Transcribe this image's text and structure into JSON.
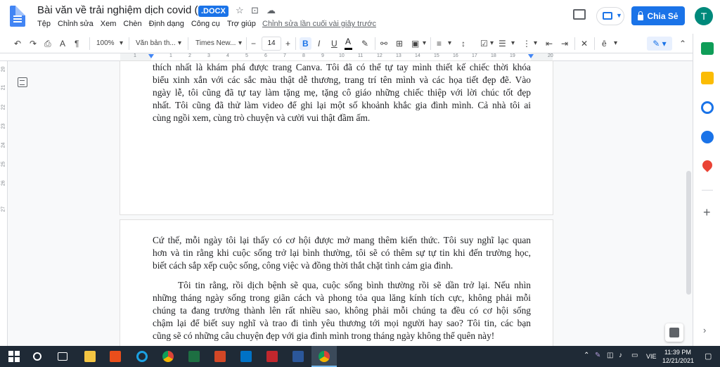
{
  "app": {
    "doc_title": "Bài văn về trải nghiệm dịch covid (1)",
    "file_badge": ".DOCX",
    "last_edit": "Chỉnh sửa lần cuối vài giây trước",
    "share_label": "Chia Sẻ",
    "avatar_initial": "T"
  },
  "menu": [
    "Tệp",
    "Chỉnh sửa",
    "Xem",
    "Chèn",
    "Định dạng",
    "Công cụ",
    "Trợ giúp"
  ],
  "toolbar": {
    "zoom": "100%",
    "style": "Văn bản th...",
    "font": "Times New...",
    "font_size": "14"
  },
  "ruler": {
    "numbers": [
      "1",
      "1",
      "2",
      "3",
      "4",
      "5",
      "6",
      "7",
      "8",
      "9",
      "10",
      "11",
      "12",
      "13",
      "14",
      "15",
      "16",
      "17",
      "18",
      "19",
      "20"
    ],
    "vertical_numbers": [
      "20",
      "21",
      "22",
      "23",
      "24",
      "25",
      "26",
      "27"
    ]
  },
  "page1": {
    "lines": [
      "thích nhất là khám phá được trang Canva. Tôi đã có thể tự tay mình thiết kế chiếc thời khóa",
      "biểu xinh xắn với các sắc màu thật dễ thương, trang trí tên mình và các họa tiết đẹp đẽ. Vào",
      "ngày lễ, tôi cũng đã tự tay làm tặng mẹ, tặng cô giáo những chiếc thiệp với lời chúc tốt đẹp",
      "nhất. Tôi cũng đã thử làm video để ghi lại một số khoảnh khắc gia đình mình. Cả nhà tôi ai",
      "cùng ngồi xem, cùng trò chuyện và cười vui thật đầm ấm."
    ]
  },
  "page2": {
    "para1": [
      "Cứ thế, mỗi ngày tôi lại thấy có cơ hội được mở mang thêm kiến thức. Tôi suy nghĩ lạc quan",
      "hơn và tin rằng khi cuộc sống trở lại bình thường, tôi sẽ có thêm sự tự tin khi đến trường học,",
      "biết cách sắp xếp cuộc sống, công việc và đồng thời thắt chặt tình cảm gia đình."
    ],
    "para2": [
      "Tôi tin rằng, rồi dịch bệnh sẽ qua, cuộc sống bình thường rồi sẽ dần trở lại. Nếu nhìn",
      "những tháng ngày sống trong giãn cách và phong tỏa qua lăng kính tích cực, không phải mỗi",
      "chúng ta đang  trưởng thành lên rất nhiều sao, không phải mỗi chúng ta đều có cơ hội sống",
      "chậm lại để biết suy nghĩ và trao đi tình yêu thương tới mọi người hay sao? Tôi tin, các bạn",
      "cũng sẽ có những câu chuyện đẹp với gia đình mình trong tháng ngày không thể quên này!"
    ]
  },
  "taskbar": {
    "language": "VIE",
    "time": "11:39 PM",
    "date": "12/21/2021"
  },
  "colors": {
    "accent": "#1a73e8",
    "avatar": "#00897b",
    "taskbar": "#1f2a36"
  }
}
